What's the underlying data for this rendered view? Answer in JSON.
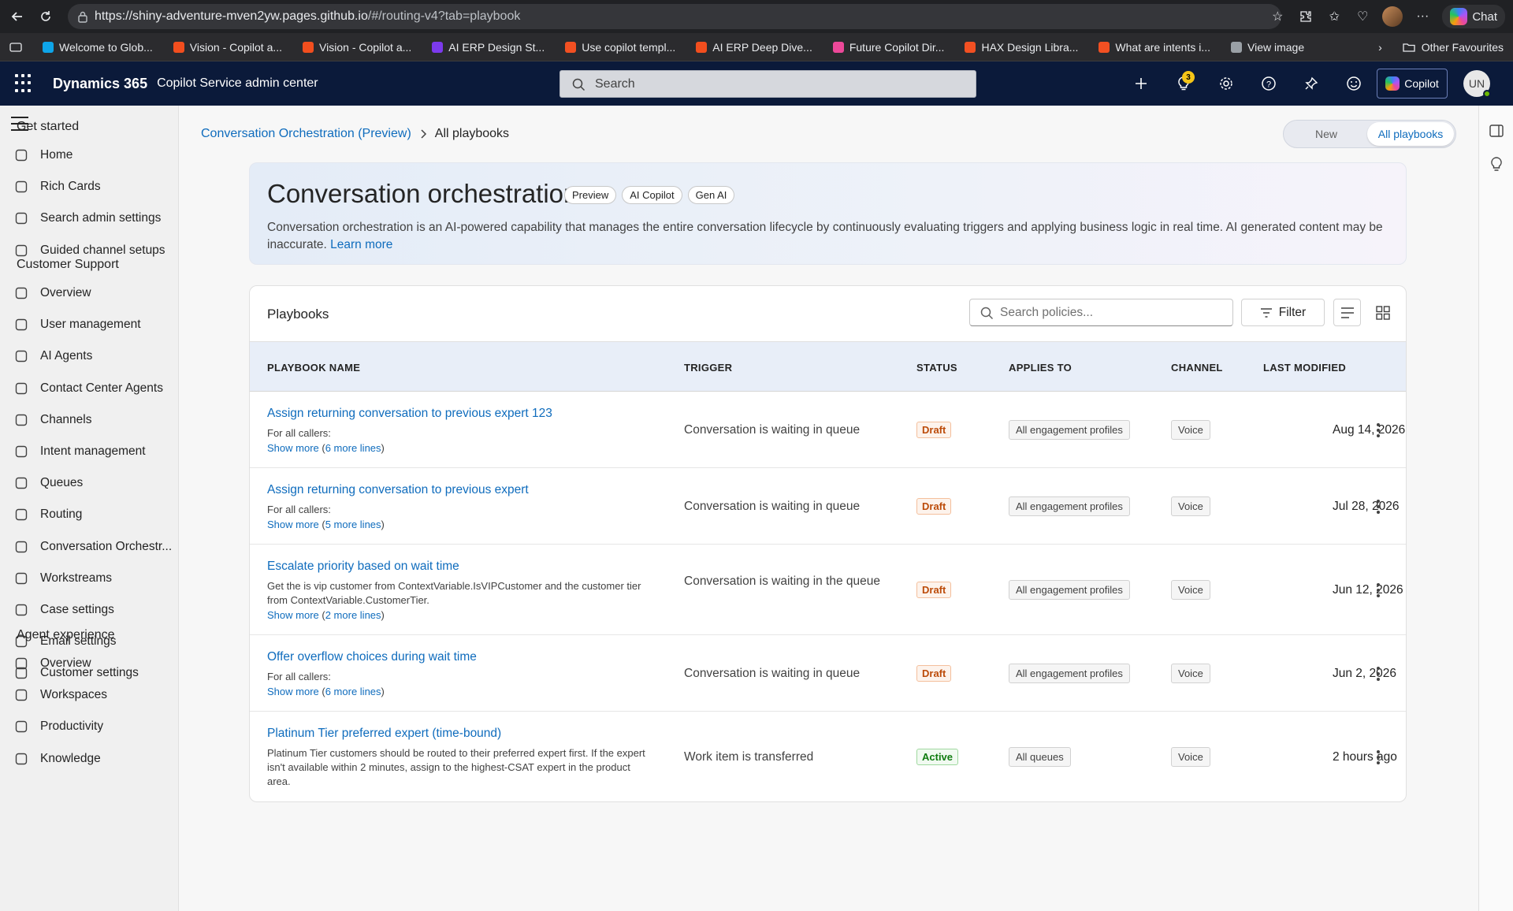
{
  "browser": {
    "url_host": "https://shiny-adventure-mven2yw.pages.github.io",
    "url_path": "/#/routing-v4?tab=playbook",
    "chat_label": "Chat",
    "favorites": [
      {
        "label": "Welcome to Glob...",
        "color": "#0ea5e9"
      },
      {
        "label": "Vision - Copilot a...",
        "color": "#f24e1e"
      },
      {
        "label": "Vision - Copilot a...",
        "color": "#f24e1e"
      },
      {
        "label": "AI ERP Design St...",
        "color": "#7c3aed"
      },
      {
        "label": "Use copilot templ...",
        "color": "#f25022"
      },
      {
        "label": "AI ERP Deep Dive...",
        "color": "#f24e1e"
      },
      {
        "label": "Future Copilot Dir...",
        "color": "#ec4899"
      },
      {
        "label": "HAX Design Libra...",
        "color": "#f25022"
      },
      {
        "label": "What are intents i...",
        "color": "#f25022"
      },
      {
        "label": "View image",
        "color": "#9aa0a6"
      }
    ],
    "other_favourites": "Other Favourites"
  },
  "header": {
    "app_name": "Dynamics 365",
    "app_sub": "Copilot Service admin center",
    "search_placeholder": "Search",
    "notification_count": "3",
    "copilot_label": "Copilot",
    "avatar_initials": "UN"
  },
  "sidebar": {
    "sections": [
      {
        "title": "Get started",
        "items": [
          "Home",
          "Rich Cards",
          "Search admin settings",
          "Guided channel setups"
        ]
      },
      {
        "title": "Customer Support",
        "items": [
          "Overview",
          "User management",
          "AI Agents",
          "Contact Center Agents",
          "Channels",
          "Intent management",
          "Queues",
          "Routing",
          "Conversation Orchestr...",
          "Workstreams",
          "Case settings",
          "Email settings",
          "Customer settings"
        ]
      },
      {
        "title": "Agent experience",
        "items": [
          "Overview",
          "Workspaces",
          "Productivity",
          "Knowledge"
        ]
      }
    ]
  },
  "breadcrumb": {
    "parent": "Conversation Orchestration (Preview)",
    "current": "All playbooks"
  },
  "view_toggle": {
    "new_label": "New",
    "all_label": "All playbooks",
    "selected": "All playbooks"
  },
  "hero": {
    "title": "Conversation orchestration",
    "tags": [
      "Preview",
      "AI Copilot",
      "Gen AI"
    ],
    "description": "Conversation orchestration is an AI-powered capability that manages the entire conversation lifecycle by continuously evaluating triggers and applying business logic in real time. AI generated content may be inaccurate.",
    "learn_more": "Learn more"
  },
  "playbooks": {
    "title": "Playbooks",
    "search_placeholder": "Search policies...",
    "filter_label": "Filter",
    "columns": {
      "name": "PLAYBOOK NAME",
      "trigger": "TRIGGER",
      "status": "STATUS",
      "applies_to": "APPLIES TO",
      "channel": "CHANNEL",
      "modified": "LAST MODIFIED"
    },
    "rows": [
      {
        "name": "Assign returning conversation to previous expert 123",
        "desc": "For all callers:",
        "show_more": "Show more",
        "more_lines": "6 more lines",
        "trigger": "Conversation is waiting in queue",
        "status": "Draft",
        "applies_to": "All engagement profiles",
        "channel": "Voice",
        "modified": "Aug 14, 2026"
      },
      {
        "name": "Assign returning conversation to previous expert",
        "desc": "For all callers:",
        "show_more": "Show more",
        "more_lines": "5 more lines",
        "trigger": "Conversation is waiting in queue",
        "status": "Draft",
        "applies_to": "All engagement profiles",
        "channel": "Voice",
        "modified": "Jul 28, 2026"
      },
      {
        "name": "Escalate priority based on wait time",
        "desc": "Get the is vip customer from ContextVariable.IsVIPCustomer and the customer tier from ContextVariable.CustomerTier.",
        "show_more": "Show more",
        "more_lines": "2 more lines",
        "trigger": "Conversation is waiting in the queue",
        "status": "Draft",
        "applies_to": "All engagement profiles",
        "channel": "Voice",
        "modified": "Jun 12, 2026"
      },
      {
        "name": "Offer overflow choices during wait time",
        "desc": "For all callers:",
        "show_more": "Show more",
        "more_lines": "6 more lines",
        "trigger": "Conversation is waiting in queue",
        "status": "Draft",
        "applies_to": "All engagement profiles",
        "channel": "Voice",
        "modified": "Jun 2, 2026"
      },
      {
        "name": "Platinum Tier preferred expert (time-bound)",
        "desc": "Platinum Tier customers should be routed to their preferred expert first. If the expert isn't available within 2 minutes, assign to the highest-CSAT expert in the product area.",
        "show_more": "",
        "more_lines": "",
        "trigger": "Work item is transferred",
        "status": "Active",
        "applies_to": "All queues",
        "channel": "Voice",
        "modified": "2 hours ago"
      }
    ]
  },
  "colors": {
    "header_bg": "#0b1a3a",
    "link": "#0f6cbd",
    "draft": "#bc4b09",
    "active": "#107c10"
  }
}
